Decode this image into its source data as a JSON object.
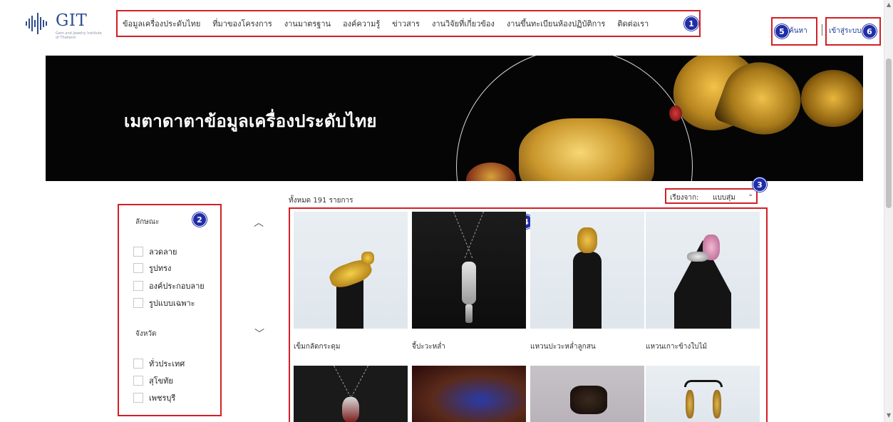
{
  "header": {
    "logo_text": "GIT",
    "logo_tagline": "Gem and Jewelry Institute of Thailand",
    "nav": [
      "ข้อมูลเครื่องประดับไทย",
      "ที่มาของโครงการ",
      "งานมาตรฐาน",
      "องค์ความรู้",
      "ข่าวสาร",
      "งานวิจัยที่เกี่ยวข้อง",
      "งานขึ้นทะเบียนห้องปฏิบัติการ",
      "ติดต่อเรา"
    ],
    "search_label": "ค้นหา",
    "login_label": "เข้าสู่ระบบ"
  },
  "hero": {
    "title": "เมตาดาตาข้อมูลเครื่องประดับไทย"
  },
  "annotations": [
    "1",
    "2",
    "3",
    "4",
    "5",
    "6"
  ],
  "filters": {
    "group1": {
      "title": "ลักษณะ",
      "chevron": "chevron-up-icon",
      "options": [
        "ลวดลาย",
        "รูปทรง",
        "องค์ประกอบลาย",
        "รูปแบบเฉพาะ"
      ]
    },
    "group2": {
      "title": "จังหวัด",
      "chevron": "chevron-down-icon",
      "options": [
        "ทั่วประเทศ",
        "สุโขทัย",
        "เพชรบุรี"
      ]
    }
  },
  "results": {
    "count_text": "ทั้งหมด 191 รายการ",
    "sort_label": "เรียงจาก:",
    "sort_value": "แบบสุ่ม",
    "items": [
      {
        "name": "เข็มกลัดกระดุม"
      },
      {
        "name": "จี้ปะวะหล่ำ"
      },
      {
        "name": "แหวนปะวะหล่ำลูกสน"
      },
      {
        "name": "แหวนเกาะข้างใบไม้"
      }
    ]
  },
  "colors": {
    "accent_blue": "#1f2ea8",
    "highlight_red": "#d31f26",
    "brand_blue": "#2d4d8f"
  }
}
